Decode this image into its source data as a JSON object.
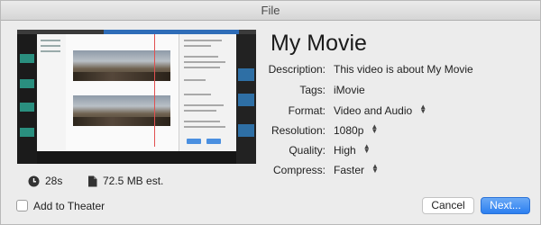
{
  "window": {
    "title": "File"
  },
  "movie": {
    "title": "My Movie"
  },
  "details": {
    "description": {
      "label": "Description:",
      "value": "This video is about My Movie"
    },
    "tags": {
      "label": "Tags:",
      "value": "iMovie"
    },
    "format": {
      "label": "Format:",
      "value": "Video and Audio"
    },
    "resolution": {
      "label": "Resolution:",
      "value": "1080p"
    },
    "quality": {
      "label": "Quality:",
      "value": "High"
    },
    "compress": {
      "label": "Compress:",
      "value": "Faster"
    }
  },
  "stats": {
    "duration": "28s",
    "size": "72.5 MB est."
  },
  "footer": {
    "add_to_theater": {
      "label": "Add to Theater",
      "checked": false
    },
    "cancel_label": "Cancel",
    "next_label": "Next..."
  },
  "icons": {
    "duration": "clock-icon",
    "size": "document-icon",
    "popup": "up-down-arrows-icon"
  },
  "colors": {
    "accent": "#2c7ff0",
    "window_bg": "#ececec"
  }
}
